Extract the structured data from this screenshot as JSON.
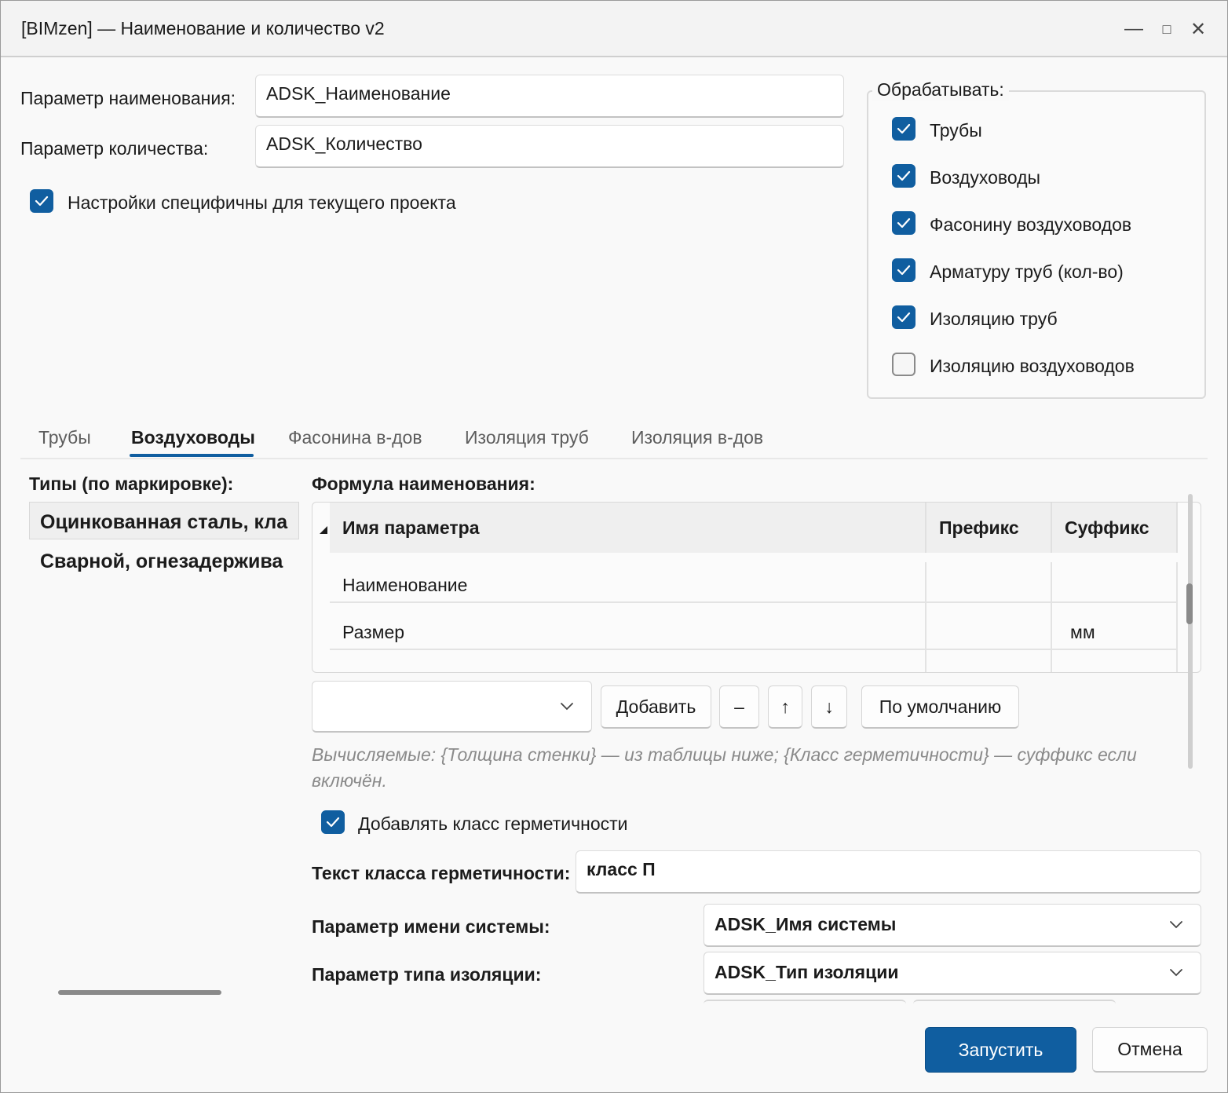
{
  "window": {
    "title": "[BIMzen] — Наименование и количество v2",
    "minimize": "—",
    "maximize": "□",
    "close": "✕"
  },
  "params": {
    "name_label": "Параметр наименования:",
    "name_value": "ADSK_Наименование",
    "qty_label": "Параметр количества:",
    "qty_value": "ADSK_Количество",
    "project_specific": "Настройки специфичны для текущего проекта"
  },
  "process": {
    "title": "Обрабатывать:",
    "items": [
      {
        "label": "Трубы",
        "checked": true
      },
      {
        "label": "Воздуховоды",
        "checked": true
      },
      {
        "label": "Фасонину воздуховодов",
        "checked": true
      },
      {
        "label": "Арматуру труб (кол-во)",
        "checked": true
      },
      {
        "label": "Изоляцию труб",
        "checked": true
      },
      {
        "label": "Изоляцию воздуховодов",
        "checked": false
      }
    ]
  },
  "tabs": [
    "Трубы",
    "Воздуховоды",
    "Фасонина в-дов",
    "Изоляция труб",
    "Изоляция в-дов"
  ],
  "types": {
    "title": "Типы (по маркировке):",
    "items": [
      "Оцинкованная сталь, кла",
      "Сварной, огнезадержива"
    ]
  },
  "formula": {
    "title": "Формула наименования:",
    "columns": [
      "Имя параметра",
      "Префикс",
      "Суффикс"
    ],
    "rows": [
      {
        "name": "Наименование",
        "prefix": "",
        "suffix": ""
      },
      {
        "name": "Размер",
        "prefix": "",
        "suffix": "мм"
      }
    ]
  },
  "toolbar": {
    "combo_value": "",
    "add": "Добавить",
    "remove": "–",
    "up": "↑",
    "down": "↓",
    "default": "По умолчанию"
  },
  "hint": "Вычисляемые: {Толщина стенки} — из таблицы ниже; {Класс герметичности} — суффикс если включён.",
  "tightness": {
    "add_label": "Добавлять класс герметичности",
    "text_label": "Текст класса герметичности:",
    "text_value": "класс П"
  },
  "system": {
    "label": "Параметр имени системы:",
    "value": "ADSK_Имя системы"
  },
  "insulation": {
    "label": "Параметр типа изоляции:",
    "value": "ADSK_Тип изоляции"
  },
  "footer": {
    "run": "Запустить",
    "cancel": "Отмена"
  },
  "colors": {
    "accent": "#105ea0"
  }
}
